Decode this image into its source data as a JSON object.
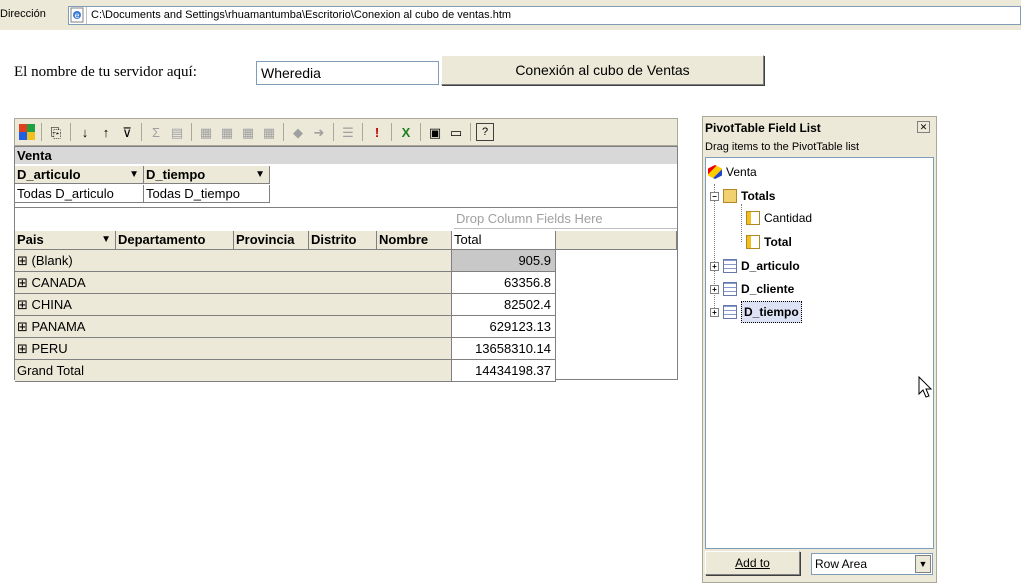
{
  "address_bar": {
    "label": "Dirección",
    "url": "C:\\Documents and Settings\\rhuamantumba\\Escritorio\\Conexion al cubo de ventas.htm"
  },
  "server": {
    "label": "El nombre de tu servidor aquí:",
    "input_value": "Wheredia",
    "connect_button": "Conexión al cubo de Ventas"
  },
  "pivot": {
    "toolbar_icons": [
      "office-logo-icon",
      "copy-icon",
      "sort-ascending-icon",
      "sort-descending-icon",
      "autofilter-icon",
      "autosum-icon",
      "subtotal-icon",
      "move-to-row-icon",
      "move-to-column-icon",
      "move-to-filter-icon",
      "move-to-detail-icon",
      "collapse-icon",
      "expand-icon",
      "hide-details-icon",
      "refresh-icon",
      "export-excel-icon",
      "field-list-icon",
      "properties-icon",
      "help-icon"
    ],
    "title": "Venta",
    "filter_fields": [
      {
        "name": "D_articulo",
        "value": "Todas D_articulo"
      },
      {
        "name": "D_tiempo",
        "value": "Todas D_tiempo"
      }
    ],
    "drop_zone": "Drop Column Fields Here",
    "row_headers": [
      "Pais",
      "Departamento",
      "Provincia",
      "Distrito",
      "Nombre"
    ],
    "total_header": "Total",
    "rows": [
      {
        "label": "⊞ (Blank)",
        "value": "905.9"
      },
      {
        "label": "⊞ CANADA",
        "value": "63356.8"
      },
      {
        "label": "⊞ CHINA",
        "value": "82502.4"
      },
      {
        "label": "⊞ PANAMA",
        "value": "629123.13"
      },
      {
        "label": "⊞ PERU",
        "value": "13658310.14"
      }
    ],
    "grand_total_label": "Grand Total",
    "grand_total_value": "14434198.37"
  },
  "field_list": {
    "title": "PivotTable Field List",
    "subtitle": "Drag items to the PivotTable list",
    "tree": {
      "root": "Venta",
      "totals": "Totals",
      "measures": [
        "Cantidad",
        "Total"
      ],
      "dimensions": [
        "D_articulo",
        "D_cliente",
        "D_tiempo"
      ]
    },
    "add_button": "Add to",
    "area_select": "Row Area"
  }
}
